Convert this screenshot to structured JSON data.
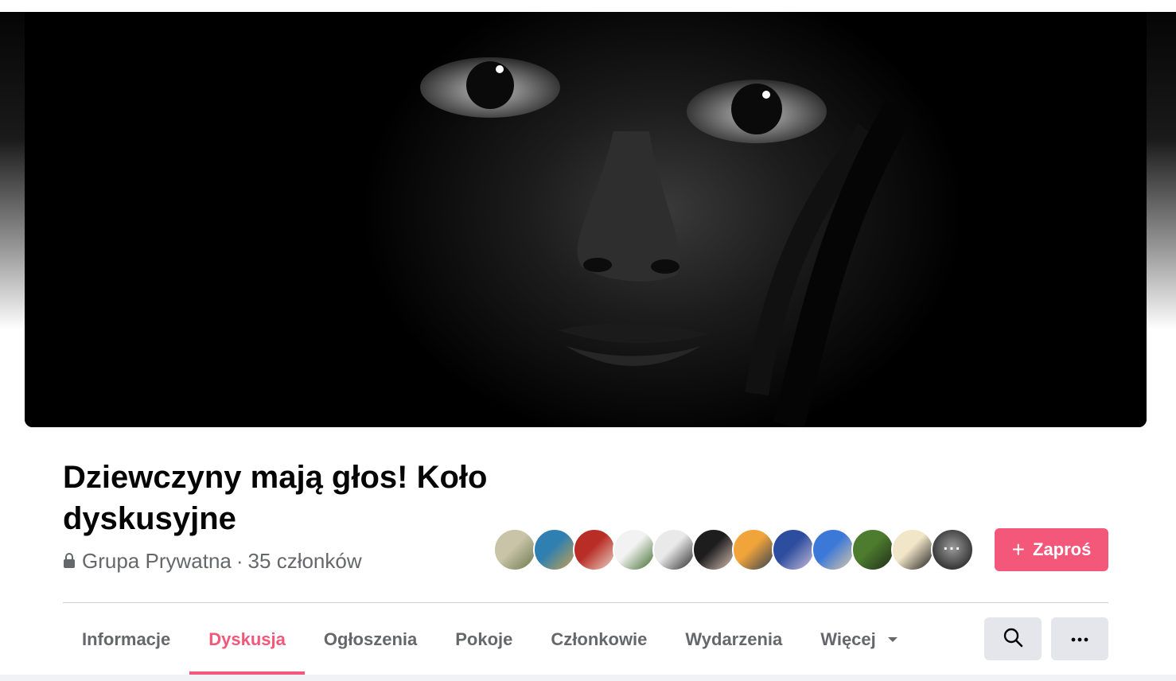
{
  "group": {
    "name": "Dziewczyny mają głos! Koło dyskusyjne",
    "privacy": "Grupa Prywatna",
    "separator": "·",
    "members": "35 członków"
  },
  "cover": {
    "icon": "cover-photo",
    "description_icon": "face-portrait"
  },
  "members_preview": {
    "avatars": [
      {
        "icon": "avatar-trees",
        "colors": [
          "#c9c4a8",
          "#6c7a4d"
        ]
      },
      {
        "icon": "avatar-dancers",
        "colors": [
          "#2f7fb1",
          "#c8a34e"
        ]
      },
      {
        "icon": "avatar-red-hair",
        "colors": [
          "#b82d26",
          "#e9d3c6"
        ]
      },
      {
        "icon": "avatar-tree",
        "colors": [
          "#f2f2f2",
          "#3e6b2a"
        ]
      },
      {
        "icon": "avatar-dress",
        "colors": [
          "#e9e9e9",
          "#2a2a2a"
        ]
      },
      {
        "icon": "avatar-woman",
        "colors": [
          "#1d1d1d",
          "#d8c3b6"
        ]
      },
      {
        "icon": "avatar-sunset",
        "colors": [
          "#f1a43a",
          "#2d3f55"
        ]
      },
      {
        "icon": "avatar-mosaic",
        "colors": [
          "#2d4e9f",
          "#c9bcd9"
        ]
      },
      {
        "icon": "avatar-city",
        "colors": [
          "#3b78d8",
          "#d9c8a8"
        ]
      },
      {
        "icon": "avatar-nature",
        "colors": [
          "#4d7c2e",
          "#1f2b1a"
        ]
      },
      {
        "icon": "avatar-blonde",
        "colors": [
          "#f2e6c9",
          "#1e1e1e"
        ]
      },
      {
        "icon": "avatar-sunglasses",
        "colors": [
          "#3a3a3a",
          "#9a9a9a"
        ]
      }
    ],
    "more_label": "···"
  },
  "invite_button": {
    "label": "Zaproś",
    "icon": "plus-icon",
    "color": "#f3587a"
  },
  "tabs": [
    {
      "label": "Informacje",
      "active": false
    },
    {
      "label": "Dyskusja",
      "active": true
    },
    {
      "label": "Ogłoszenia",
      "active": false
    },
    {
      "label": "Pokoje",
      "active": false
    },
    {
      "label": "Członkowie",
      "active": false
    },
    {
      "label": "Wydarzenia",
      "active": false
    },
    {
      "label": "Więcej",
      "active": false,
      "dropdown": true
    }
  ],
  "actions": {
    "search": {
      "icon": "search-icon"
    },
    "more": {
      "icon": "more-horizontal-icon"
    }
  },
  "accent_color": "#f3587a"
}
